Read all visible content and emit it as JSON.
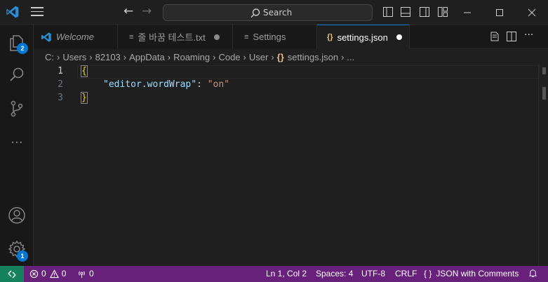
{
  "titlebar": {
    "search_label": "Search",
    "icons": [
      "vscode-logo",
      "menu-icon",
      "back-arrow-icon",
      "forward-arrow-icon",
      "search-icon",
      "toggle-primary-sidebar-icon",
      "toggle-panel-icon",
      "toggle-secondary-sidebar-icon",
      "customize-layout-icon"
    ],
    "window_controls": [
      "minimize",
      "maximize",
      "close"
    ]
  },
  "activity_bar": {
    "items": [
      {
        "name": "explorer",
        "icon": "files-icon",
        "badge": "2"
      },
      {
        "name": "search",
        "icon": "search-icon"
      },
      {
        "name": "source-control",
        "icon": "source-control-icon"
      },
      {
        "name": "more",
        "icon": "ellipsis-icon",
        "label": "···"
      }
    ],
    "bottom": [
      {
        "name": "accounts",
        "icon": "account-icon"
      },
      {
        "name": "manage",
        "icon": "gear-icon",
        "badge": "1"
      }
    ]
  },
  "tabs": [
    {
      "label": "Welcome",
      "icon": "vscode-logo",
      "italic": true
    },
    {
      "label": "줄 바꿈 테스트.txt",
      "icon": "file-lines-icon",
      "dirty": true
    },
    {
      "label": "Settings",
      "icon": "file-lines-icon"
    },
    {
      "label": "settings.json",
      "icon": "json-braces-icon",
      "braces": "{}",
      "dirty": true,
      "active": true
    }
  ],
  "breadcrumb": {
    "segments": [
      "C:",
      "Users",
      "82103",
      "AppData",
      "Roaming",
      "Code",
      "User"
    ],
    "file_icon": "{}",
    "file": "settings.json",
    "more": "..."
  },
  "editor": {
    "lines": [
      {
        "num": "1",
        "open": "{"
      },
      {
        "num": "2",
        "key": "\"editor.wordWrap\"",
        "colon": ": ",
        "value": "\"on\""
      },
      {
        "num": "3",
        "close": "}"
      }
    ],
    "colors": {
      "key": "#9cdcfe",
      "string": "#ce9178",
      "bracket": "#ffd700",
      "accent": "#0078d4"
    }
  },
  "status_bar": {
    "color": "#68217a",
    "remote_color": "#16825d",
    "errors": "0",
    "warnings": "0",
    "ports": "0",
    "position": "Ln 1, Col 2",
    "spaces": "Spaces: 4",
    "encoding": "UTF-8",
    "eol": "CRLF",
    "language_icon": "{ }",
    "language": "JSON with Comments"
  }
}
